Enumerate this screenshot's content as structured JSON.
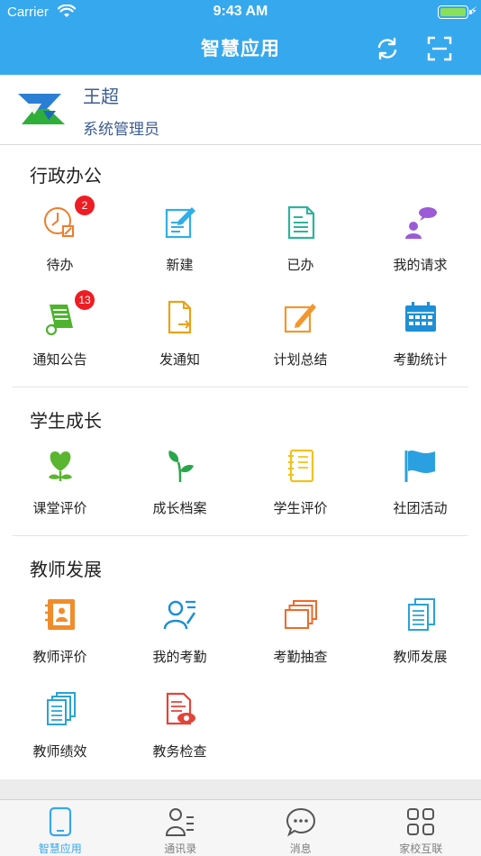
{
  "status_bar": {
    "carrier": "Carrier",
    "time": "9:43 AM"
  },
  "header": {
    "title": "智慧应用"
  },
  "profile": {
    "name": "王超",
    "role": "系统管理员"
  },
  "sections": [
    {
      "title": "行政办公",
      "items": [
        {
          "label": "待办",
          "icon": "clock-icon",
          "badge": "2",
          "color": "#f07c2b"
        },
        {
          "label": "新建",
          "icon": "edit-document-icon",
          "badge": "",
          "color": "#30aee8"
        },
        {
          "label": "已办",
          "icon": "checked-document-icon",
          "badge": "",
          "color": "#2eb39b"
        },
        {
          "label": "我的请求",
          "icon": "user-chat-icon",
          "badge": "",
          "color": "#9b5bd6"
        },
        {
          "label": "通知公告",
          "icon": "scroll-notice-icon",
          "badge": "13",
          "color": "#4fb330"
        },
        {
          "label": "发通知",
          "icon": "send-file-icon",
          "badge": "",
          "color": "#e9a216"
        },
        {
          "label": "计划总结",
          "icon": "pencil-note-icon",
          "badge": "",
          "color": "#f2962e"
        },
        {
          "label": "考勤统计",
          "icon": "calendar-icon",
          "badge": "",
          "color": "#1d8fd6"
        }
      ]
    },
    {
      "title": "学生成长",
      "items": [
        {
          "label": "课堂评价",
          "icon": "heart-plant-icon",
          "badge": "",
          "color": "#5ab531"
        },
        {
          "label": "成长档案",
          "icon": "sprout-icon",
          "badge": "",
          "color": "#2aa64a"
        },
        {
          "label": "学生评价",
          "icon": "notebook-icon",
          "badge": "",
          "color": "#f2c21b"
        },
        {
          "label": "社团活动",
          "icon": "flag-icon",
          "badge": "",
          "color": "#2aa0e0"
        }
      ]
    },
    {
      "title": "教师发展",
      "items": [
        {
          "label": "教师评价",
          "icon": "contact-book-icon",
          "badge": "",
          "color": "#f08c2a"
        },
        {
          "label": "我的考勤",
          "icon": "user-list-icon",
          "badge": "",
          "color": "#1d8fd6"
        },
        {
          "label": "考勤抽查",
          "icon": "stacked-cards-icon",
          "badge": "",
          "color": "#ee6a2a"
        },
        {
          "label": "教师发展",
          "icon": "documents-icon",
          "badge": "",
          "color": "#29a3d6"
        },
        {
          "label": "教师绩效",
          "icon": "files-stack-icon",
          "badge": "",
          "color": "#29a3d6"
        },
        {
          "label": "教务检查",
          "icon": "document-eye-icon",
          "badge": "",
          "color": "#e2443a"
        }
      ]
    }
  ],
  "tabs": [
    {
      "label": "智慧应用",
      "icon": "tablet-icon",
      "active": true
    },
    {
      "label": "通讯录",
      "icon": "contacts-icon",
      "active": false
    },
    {
      "label": "消息",
      "icon": "chat-bubble-icon",
      "active": false
    },
    {
      "label": "家校互联",
      "icon": "grid-apps-icon",
      "active": false
    }
  ],
  "colors": {
    "accent": "#36a8ee",
    "badge": "#ee1d23",
    "name_text": "#3d5d93"
  }
}
